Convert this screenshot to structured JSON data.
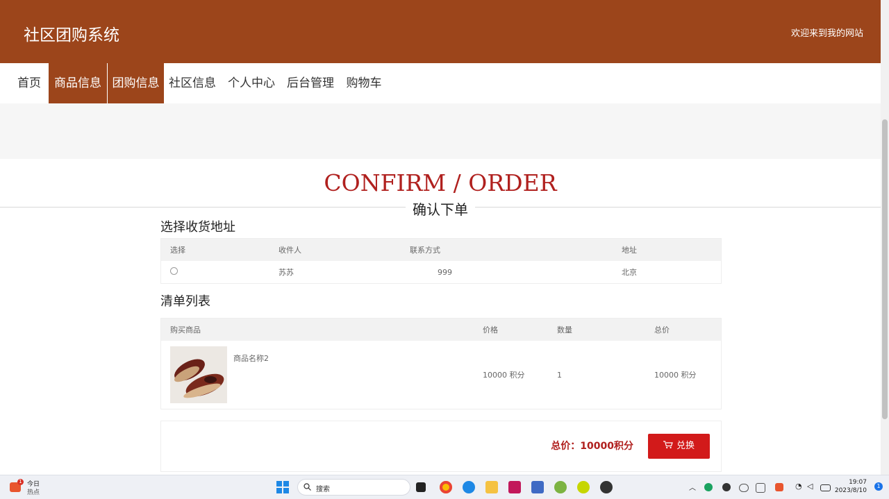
{
  "header": {
    "site_title": "社区团购系统",
    "welcome": "欢迎来到我的网站"
  },
  "nav": {
    "items": [
      {
        "label": "首页"
      },
      {
        "label": "商品信息"
      },
      {
        "label": "团购信息"
      },
      {
        "label": "社区信息"
      },
      {
        "label": "个人中心"
      },
      {
        "label": "后台管理"
      },
      {
        "label": "购物车"
      }
    ]
  },
  "page_heading": {
    "english": "CONFIRM / ORDER",
    "chinese": "确认下单"
  },
  "address_section": {
    "title": "选择收货地址",
    "columns": [
      "选择",
      "收件人",
      "联系方式",
      "地址"
    ],
    "rows": [
      {
        "recipient": "苏苏",
        "phone": "999",
        "address": "北京"
      }
    ]
  },
  "list_section": {
    "title": "清单列表",
    "columns": [
      "购买商品",
      "价格",
      "数量",
      "总价"
    ],
    "rows": [
      {
        "name": "商品名称2",
        "price": "10000 积分",
        "qty": "1",
        "total": "10000 积分"
      }
    ]
  },
  "summary": {
    "total_label": "总价：10000积分",
    "button_label": "兑换"
  },
  "taskbar": {
    "widget_line1": "今日",
    "widget_line2": "热点",
    "search_label": "搜索",
    "time": "19:07",
    "date": "2023/8/10",
    "notify_count": "1"
  },
  "colors": {
    "brand": "#9c451b",
    "accent_red": "#b0201e",
    "button_red": "#d21a1a"
  }
}
